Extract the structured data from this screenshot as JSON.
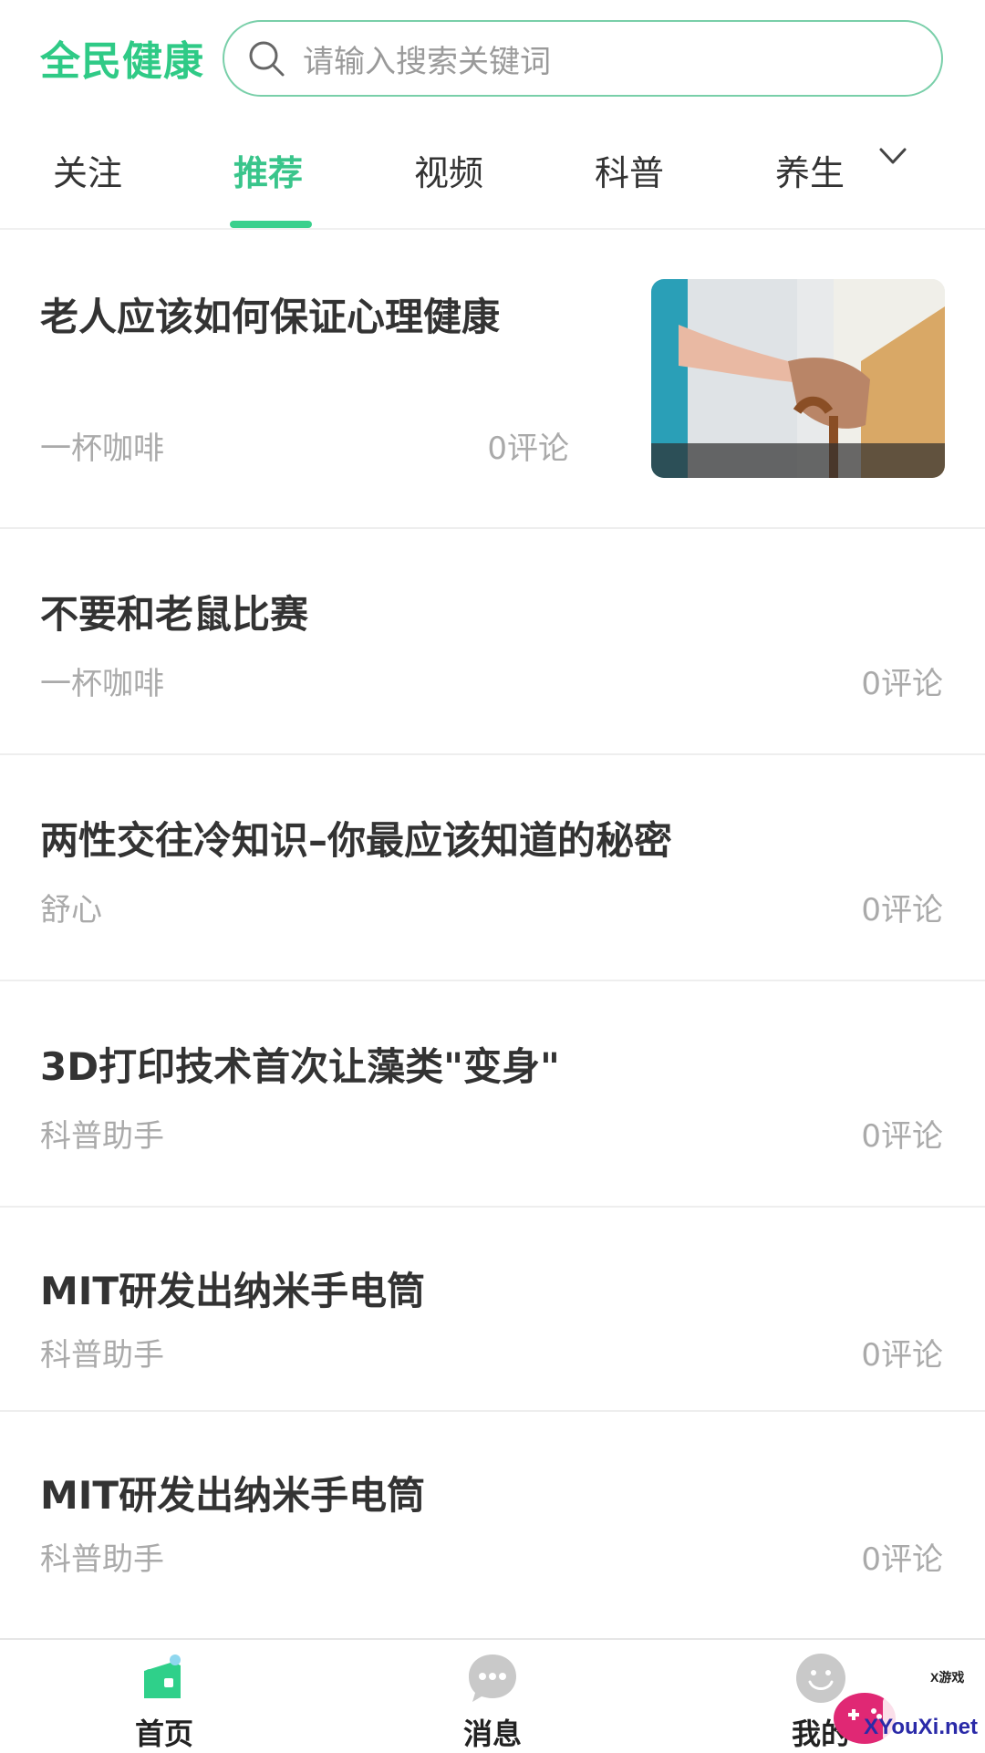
{
  "header": {
    "logo_text": "全民健康",
    "search_placeholder": "请输入搜索关键词",
    "search_icon": "search-icon"
  },
  "tabs": [
    {
      "label": "关注",
      "active": false
    },
    {
      "label": "推荐",
      "active": true
    },
    {
      "label": "视频",
      "active": false
    },
    {
      "label": "科普",
      "active": false
    },
    {
      "label": "养生",
      "active": false
    }
  ],
  "tabs_more_icon": "chevron-down-icon",
  "articles": [
    {
      "title": "老人应该如何保证心理健康",
      "source": "一杯咖啡",
      "comments": "0评论",
      "has_image": true
    },
    {
      "title": "不要和老鼠比赛",
      "source": "一杯咖啡",
      "comments": "0评论"
    },
    {
      "title": "两性交往冷知识–你最应该知道的秘密",
      "source": "舒心",
      "comments": "0评论"
    },
    {
      "title": "3D打印技术首次让藻类\"变身\"",
      "source": "科普助手",
      "comments": "0评论"
    },
    {
      "title": "MIT研发出纳米手电筒",
      "source": "科普助手",
      "comments": "0评论"
    },
    {
      "title": "MIT研发出纳米手电筒",
      "source": "科普助手",
      "comments": "0评论"
    }
  ],
  "bottom_nav": [
    {
      "label": "首页",
      "icon": "home-icon",
      "active": true
    },
    {
      "label": "消息",
      "icon": "message-icon",
      "active": false
    },
    {
      "label": "我的",
      "icon": "profile-icon",
      "active": false
    }
  ],
  "watermark": {
    "small_text": "X游戏",
    "text": "XYouXi.net"
  },
  "colors": {
    "accent": "#3ad08d",
    "logo": "#2fca86",
    "text": "#333333",
    "muted": "#aaaaaa"
  }
}
